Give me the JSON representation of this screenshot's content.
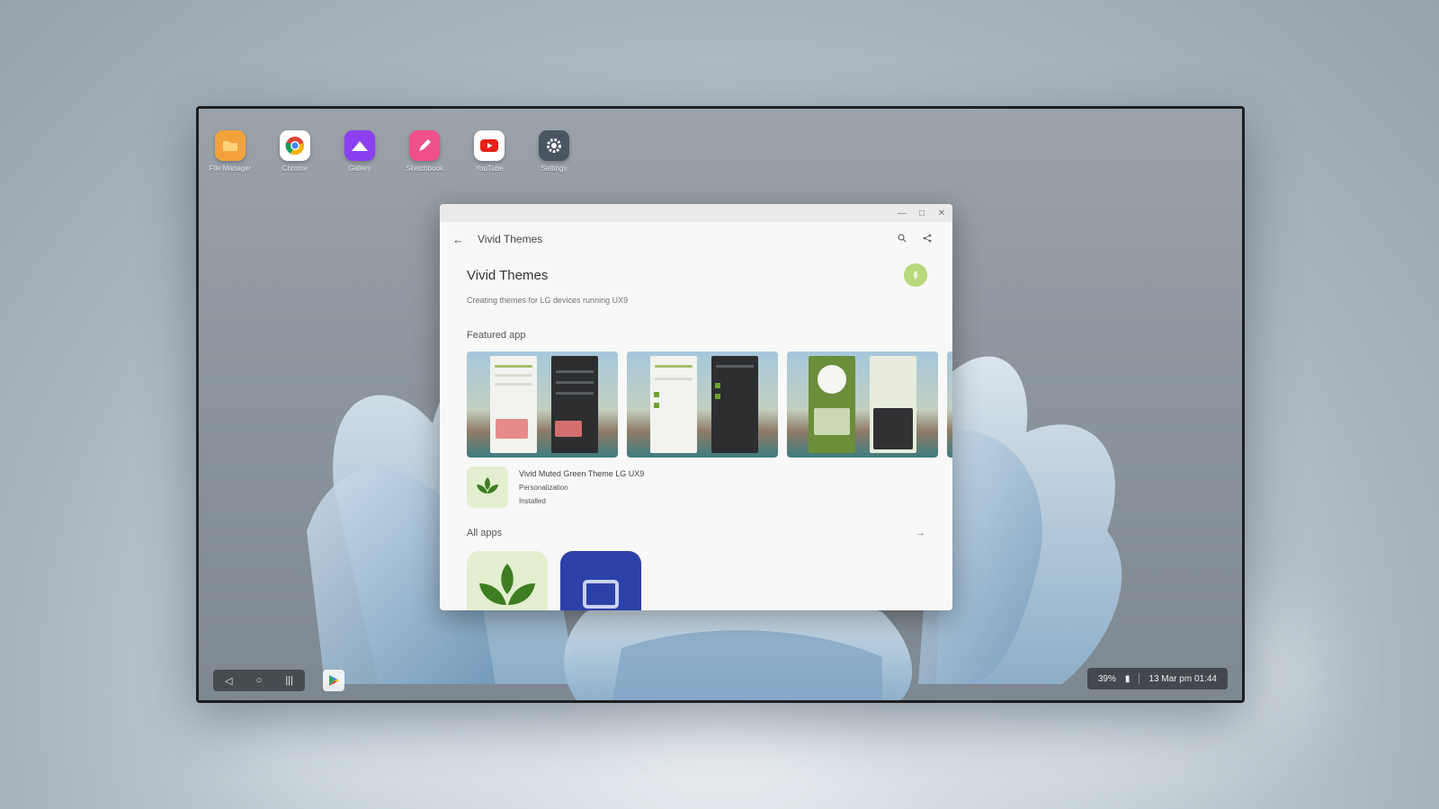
{
  "desktop": {
    "icons": [
      {
        "label": "File Manager",
        "icon": "folder-icon",
        "color": "#f2a23a"
      },
      {
        "label": "Chrome",
        "icon": "chrome-icon",
        "color": "#ffffff"
      },
      {
        "label": "Gallery",
        "icon": "gallery-icon",
        "color": "#8a3ff0"
      },
      {
        "label": "Sketchbook",
        "icon": "pen-icon",
        "color": "#f0508a"
      },
      {
        "label": "YouTube",
        "icon": "youtube-icon",
        "color": "#ffffff"
      },
      {
        "label": "Settings",
        "icon": "gear-icon",
        "color": "#4a5562"
      }
    ]
  },
  "window": {
    "appbar_title": "Vivid Themes",
    "developer_name": "Vivid Themes",
    "developer_description": "Creating themes for LG devices running UX9",
    "featured_section": "Featured app",
    "featured_app": {
      "name": "Vivid Muted Green Theme LG UX9",
      "category": "Personalization",
      "status": "Installed"
    },
    "all_apps_section": "All apps"
  },
  "taskbar": {
    "battery": "39%",
    "datetime": "13 Mar pm 01:44"
  },
  "colors": {
    "accent_green": "#b8d87c",
    "window_bg": "#f7f8f7",
    "taskbar_pill": "#2c3034"
  }
}
